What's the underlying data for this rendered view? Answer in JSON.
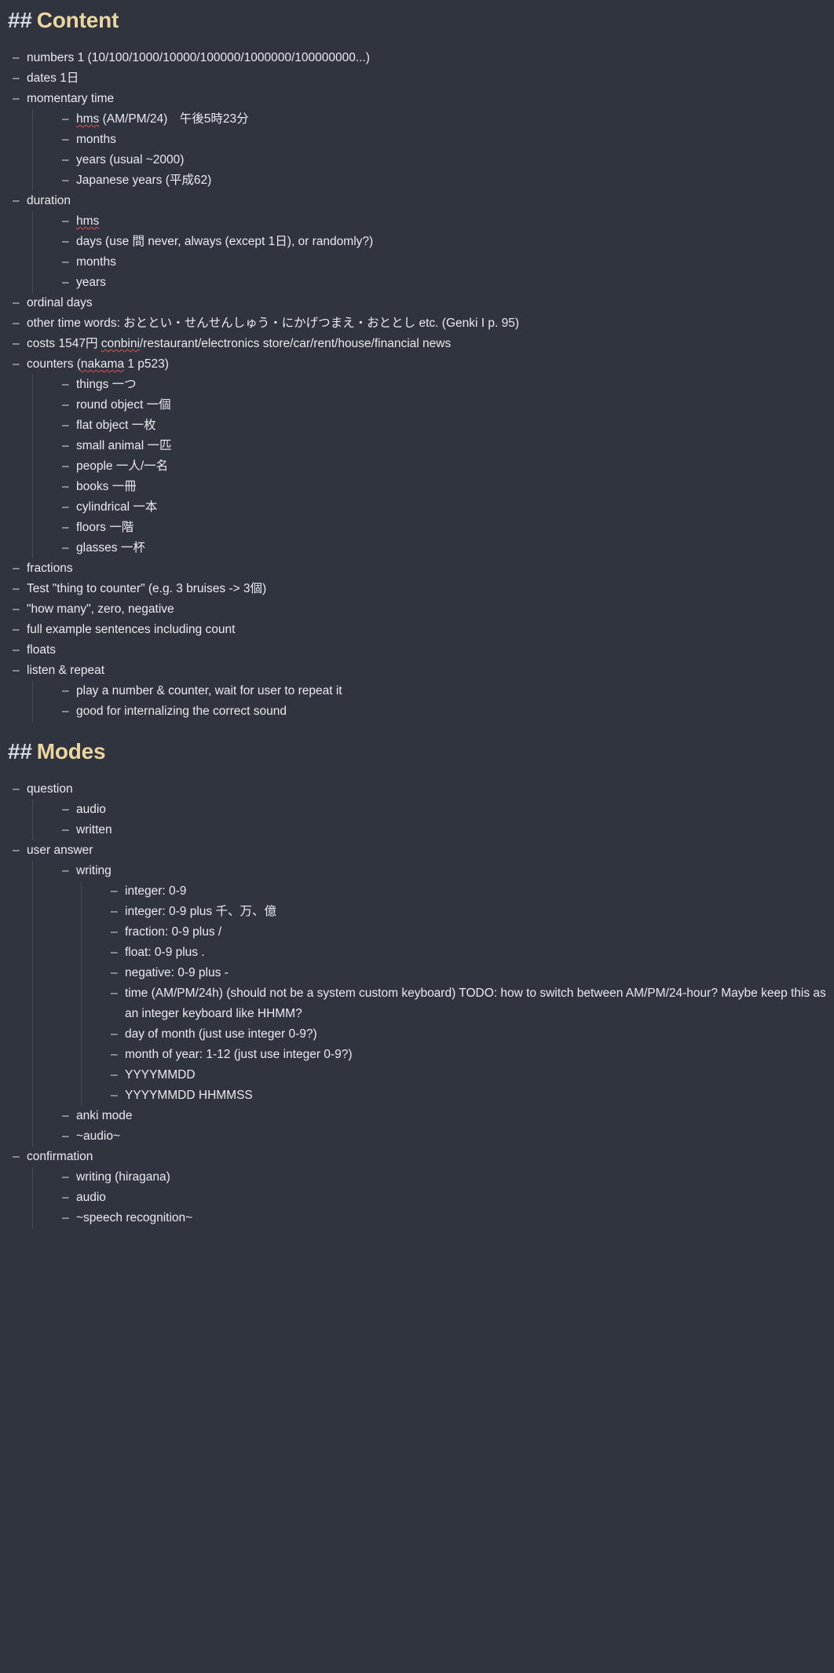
{
  "colors": {
    "background": "#30343f",
    "text": "#e8eaef",
    "heading_accent": "#ecd6a0",
    "heading_hash": "#d6dae3",
    "guide_line": "#454a58",
    "spellcheck_underline": "#d9534f"
  },
  "sections": [
    {
      "hash": "##",
      "title": "Content",
      "items": [
        {
          "text": "numbers 1 (10/100/1000/10000/100000/1000000/100000000...)"
        },
        {
          "text": "dates 1日"
        },
        {
          "text": "momentary time",
          "children": [
            {
              "text": "hms (AM/PM/24)　午後5時23分",
              "misspelled": "hms"
            },
            {
              "text": "months"
            },
            {
              "text": "years (usual ~2000)"
            },
            {
              "text": "Japanese years (平成62)"
            }
          ]
        },
        {
          "text": "duration",
          "children": [
            {
              "text": "hms",
              "misspelled": "hms"
            },
            {
              "text": "days (use 間 never, always (except 1日), or randomly?)"
            },
            {
              "text": "months"
            },
            {
              "text": "years"
            }
          ]
        },
        {
          "text": "ordinal days"
        },
        {
          "text": "other time words: おととい・せんせんしゅう・にかげつまえ・おととし etc. (Genki I p. 95)"
        },
        {
          "text": "costs 1547円 conbini/restaurant/electronics store/car/rent/house/financial news",
          "misspelled": "conbini"
        },
        {
          "text": "counters (nakama 1 p523)",
          "misspelled": "nakama",
          "children": [
            {
              "text": "things 一つ"
            },
            {
              "text": "round object 一個"
            },
            {
              "text": "flat object 一枚"
            },
            {
              "text": "small animal 一匹"
            },
            {
              "text": "people 一人/一名"
            },
            {
              "text": "books 一冊"
            },
            {
              "text": "cylindrical 一本"
            },
            {
              "text": "floors 一階"
            },
            {
              "text": "glasses 一杯"
            }
          ]
        },
        {
          "text": "fractions"
        },
        {
          "text": "Test \"thing to counter\" (e.g. 3 bruises -> 3個)"
        },
        {
          "text": "\"how many\", zero, negative"
        },
        {
          "text": "full example sentences including count"
        },
        {
          "text": "floats"
        },
        {
          "text": "listen & repeat",
          "children": [
            {
              "text": "play a number & counter, wait for user to repeat it"
            },
            {
              "text": "good for internalizing the correct sound"
            }
          ]
        }
      ]
    },
    {
      "hash": "##",
      "title": "Modes",
      "items": [
        {
          "text": "question",
          "children": [
            {
              "text": "audio"
            },
            {
              "text": "written"
            }
          ]
        },
        {
          "text": "user answer",
          "children": [
            {
              "text": "writing",
              "children": [
                {
                  "text": "integer: 0-9"
                },
                {
                  "text": "integer: 0-9 plus 千、万、億"
                },
                {
                  "text": "fraction: 0-9 plus /"
                },
                {
                  "text": "float: 0-9 plus ."
                },
                {
                  "text": "negative: 0-9 plus -"
                },
                {
                  "text": "time (AM/PM/24h) (should not be a system custom keyboard) TODO: how to switch between AM/PM/24-hour? Maybe keep this as an integer keyboard like HHMM?"
                },
                {
                  "text": "day of month (just use integer 0-9?)"
                },
                {
                  "text": "month of year: 1-12 (just use integer 0-9?)"
                },
                {
                  "text": "YYYYMMDD"
                },
                {
                  "text": "YYYYMMDD HHMMSS"
                }
              ]
            },
            {
              "text": "anki mode"
            },
            {
              "text": "~audio~"
            }
          ]
        },
        {
          "text": "confirmation",
          "children": [
            {
              "text": "writing (hiragana)"
            },
            {
              "text": "audio"
            },
            {
              "text": "~speech recognition~"
            }
          ]
        }
      ]
    }
  ]
}
